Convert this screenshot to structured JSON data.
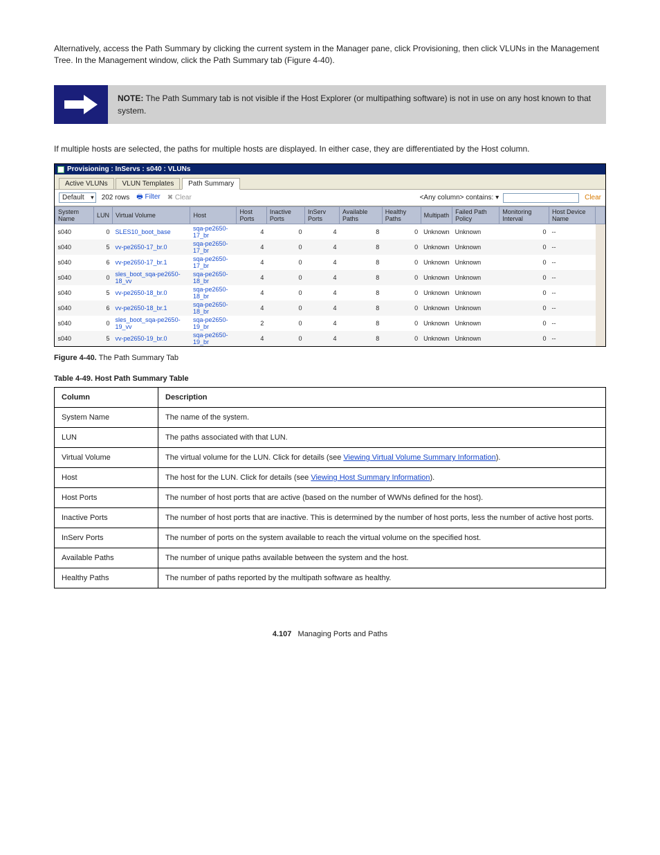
{
  "intro": "Alternatively, access the Path Summary by clicking the current system in the Manager pane, click Provisioning, then click VLUNs in the Management Tree. In the Management window, click the Path Summary tab (Figure 4-40).",
  "note": {
    "title": "NOTE:",
    "body": "The Path Summary tab is not visible if the Host Explorer (or multipathing software) is not in use on any host known to that system."
  },
  "after_note": "If multiple hosts are selected, the paths for multiple hosts are displayed. In either case, they are differentiated by the Host column.",
  "shot": {
    "title": "Provisioning : InServs : s040 : VLUNs",
    "tabs": [
      "Active VLUNs",
      "VLUN Templates",
      "Path Summary"
    ],
    "active_tab": 2,
    "toolbar": {
      "layout_label": "Default",
      "rows_label": "202 rows",
      "filter_label": "Filter",
      "clear_disabled_label": "Clear",
      "search_label": "<Any column> contains:  ▾",
      "clear_label": "Clear"
    },
    "columns": [
      "System Name",
      "LUN",
      "Virtual Volume",
      "Host",
      "Host Ports",
      "Inactive Ports",
      "InServ Ports",
      "Available Paths",
      "Healthy Paths",
      "Multipath",
      "Failed Path Policy",
      "Monitoring Interval",
      "Host Device Name"
    ],
    "rows": [
      {
        "sys": "s040",
        "lun": "0",
        "vv": "SLES10_boot_base",
        "host": "sqa-pe2650-17_br",
        "hp": "4",
        "ip": "0",
        "sp": "4",
        "ap": "8",
        "hpth": "0",
        "mp": "Unknown",
        "fp": "Unknown",
        "mi": "0",
        "hd": "--"
      },
      {
        "sys": "s040",
        "lun": "5",
        "vv": "vv-pe2650-17_br.0",
        "host": "sqa-pe2650-17_br",
        "hp": "4",
        "ip": "0",
        "sp": "4",
        "ap": "8",
        "hpth": "0",
        "mp": "Unknown",
        "fp": "Unknown",
        "mi": "0",
        "hd": "--"
      },
      {
        "sys": "s040",
        "lun": "6",
        "vv": "vv-pe2650-17_br.1",
        "host": "sqa-pe2650-17_br",
        "hp": "4",
        "ip": "0",
        "sp": "4",
        "ap": "8",
        "hpth": "0",
        "mp": "Unknown",
        "fp": "Unknown",
        "mi": "0",
        "hd": "--"
      },
      {
        "sys": "s040",
        "lun": "0",
        "vv": "sles_boot_sqa-pe2650-18_vv",
        "host": "sqa-pe2650-18_br",
        "hp": "4",
        "ip": "0",
        "sp": "4",
        "ap": "8",
        "hpth": "0",
        "mp": "Unknown",
        "fp": "Unknown",
        "mi": "0",
        "hd": "--"
      },
      {
        "sys": "s040",
        "lun": "5",
        "vv": "vv-pe2650-18_br.0",
        "host": "sqa-pe2650-18_br",
        "hp": "4",
        "ip": "0",
        "sp": "4",
        "ap": "8",
        "hpth": "0",
        "mp": "Unknown",
        "fp": "Unknown",
        "mi": "0",
        "hd": "--"
      },
      {
        "sys": "s040",
        "lun": "6",
        "vv": "vv-pe2650-18_br.1",
        "host": "sqa-pe2650-18_br",
        "hp": "4",
        "ip": "0",
        "sp": "4",
        "ap": "8",
        "hpth": "0",
        "mp": "Unknown",
        "fp": "Unknown",
        "mi": "0",
        "hd": "--"
      },
      {
        "sys": "s040",
        "lun": "0",
        "vv": "sles_boot_sqa-pe2650-19_vv",
        "host": "sqa-pe2650-19_br",
        "hp": "2",
        "ip": "0",
        "sp": "4",
        "ap": "8",
        "hpth": "0",
        "mp": "Unknown",
        "fp": "Unknown",
        "mi": "0",
        "hd": "--"
      },
      {
        "sys": "s040",
        "lun": "5",
        "vv": "vv-pe2650-19_br.0",
        "host": "sqa-pe2650-19_br",
        "hp": "4",
        "ip": "0",
        "sp": "4",
        "ap": "8",
        "hpth": "0",
        "mp": "Unknown",
        "fp": "Unknown",
        "mi": "0",
        "hd": "--"
      }
    ]
  },
  "figure_caption_label": "Figure 4-40.",
  "figure_caption": "The Path Summary Tab",
  "table_caption": "Table 4-49.  Host Path Summary Table",
  "desc_header": {
    "c1": "Column",
    "c2": "Description"
  },
  "desc_rows": [
    {
      "c1": "System Name",
      "c2": "The name of the system."
    },
    {
      "c1": "LUN",
      "c2": "The paths associated with that LUN."
    },
    {
      "c1": "Virtual Volume",
      "c2_pre": "The virtual volume for the LUN. Click for details (see ",
      "c2_link": "Viewing Virtual Volume Summary Information",
      "c2_post": ")."
    },
    {
      "c1": "Host",
      "c2_pre": "The host for the LUN. Click for details (see ",
      "c2_link": "Viewing Host Summary Information",
      "c2_post": ")."
    },
    {
      "c1": "Host Ports",
      "c2": "The number of host ports that are active (based on the number of WWNs defined for the host)."
    },
    {
      "c1": "Inactive Ports",
      "c2": "The number of host ports that are inactive. This is determined by the number of host ports, less the number of active host ports."
    },
    {
      "c1": "InServ Ports",
      "c2": "The number of ports on the system available to reach the virtual volume on the specified host."
    },
    {
      "c1": "Available Paths",
      "c2": "The number of unique paths available between the system and the host."
    },
    {
      "c1": "Healthy Paths",
      "c2": "The number of paths reported by the multipath software as healthy."
    }
  ],
  "footer": {
    "num": "4.107",
    "label": "Managing Ports and Paths",
    "page": "4"
  }
}
